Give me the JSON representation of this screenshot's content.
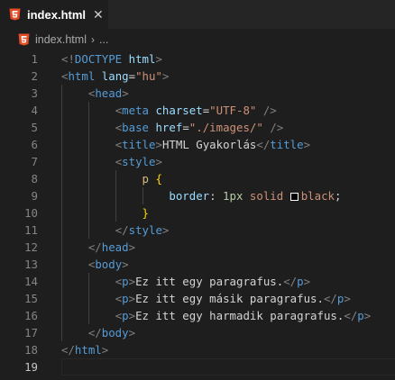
{
  "tab": {
    "filename": "index.html",
    "close_glyph": "✕",
    "icon": "html5-icon"
  },
  "breadcrumb": {
    "filename": "index.html",
    "separator": "›",
    "ellipsis": "..."
  },
  "colors": {
    "html_icon": "#e44d26",
    "tag": "#569cd6",
    "attr": "#9cdcfe",
    "string": "#ce9178",
    "bracket": "#808080"
  },
  "editor": {
    "active_line": 19,
    "lines": [
      {
        "n": "1",
        "tokens": [
          [
            "br",
            "<!"
          ],
          [
            "tag",
            "DOCTYPE"
          ],
          [
            "txt",
            " "
          ],
          [
            "attr",
            "html"
          ],
          [
            "br",
            ">"
          ]
        ]
      },
      {
        "n": "2",
        "tokens": [
          [
            "br",
            "<"
          ],
          [
            "tag",
            "html"
          ],
          [
            "txt",
            " "
          ],
          [
            "attr",
            "lang"
          ],
          [
            "txt",
            "="
          ],
          [
            "str",
            "\"hu\""
          ],
          [
            "br",
            ">"
          ]
        ]
      },
      {
        "n": "3",
        "indent": 1,
        "tokens": [
          [
            "br",
            "<"
          ],
          [
            "tag",
            "head"
          ],
          [
            "br",
            ">"
          ]
        ]
      },
      {
        "n": "4",
        "indent": 2,
        "tokens": [
          [
            "br",
            "<"
          ],
          [
            "tag",
            "meta"
          ],
          [
            "txt",
            " "
          ],
          [
            "attr",
            "charset"
          ],
          [
            "txt",
            "="
          ],
          [
            "str",
            "\"UTF-8\""
          ],
          [
            "txt",
            " "
          ],
          [
            "br",
            "/>"
          ]
        ]
      },
      {
        "n": "5",
        "indent": 2,
        "tokens": [
          [
            "br",
            "<"
          ],
          [
            "tag",
            "base"
          ],
          [
            "txt",
            " "
          ],
          [
            "attr",
            "href"
          ],
          [
            "txt",
            "="
          ],
          [
            "str",
            "\"./images/\""
          ],
          [
            "txt",
            " "
          ],
          [
            "br",
            "/>"
          ]
        ]
      },
      {
        "n": "6",
        "indent": 2,
        "tokens": [
          [
            "br",
            "<"
          ],
          [
            "tag",
            "title"
          ],
          [
            "br",
            ">"
          ],
          [
            "txt",
            "HTML Gyakorlás"
          ],
          [
            "br",
            "</"
          ],
          [
            "tag",
            "title"
          ],
          [
            "br",
            ">"
          ]
        ]
      },
      {
        "n": "7",
        "indent": 2,
        "tokens": [
          [
            "br",
            "<"
          ],
          [
            "tag",
            "style"
          ],
          [
            "br",
            ">"
          ]
        ]
      },
      {
        "n": "8",
        "indent": 3,
        "tokens": [
          [
            "sel",
            "p"
          ],
          [
            "txt",
            " "
          ],
          [
            "brace",
            "{"
          ]
        ]
      },
      {
        "n": "9",
        "indent": 4,
        "tokens": [
          [
            "prop",
            "border"
          ],
          [
            "txt",
            ": "
          ],
          [
            "num",
            "1px"
          ],
          [
            "txt",
            " "
          ],
          [
            "str",
            "solid"
          ],
          [
            "txt",
            " "
          ],
          [
            "swatch",
            ""
          ],
          [
            "str",
            "black"
          ],
          [
            "txt",
            ";"
          ]
        ]
      },
      {
        "n": "10",
        "indent": 3,
        "tokens": [
          [
            "brace",
            "}"
          ]
        ]
      },
      {
        "n": "11",
        "indent": 2,
        "tokens": [
          [
            "br",
            "</"
          ],
          [
            "tag",
            "style"
          ],
          [
            "br",
            ">"
          ]
        ]
      },
      {
        "n": "12",
        "indent": 1,
        "tokens": [
          [
            "br",
            "</"
          ],
          [
            "tag",
            "head"
          ],
          [
            "br",
            ">"
          ]
        ]
      },
      {
        "n": "13",
        "indent": 1,
        "tokens": [
          [
            "br",
            "<"
          ],
          [
            "tag",
            "body"
          ],
          [
            "br",
            ">"
          ]
        ]
      },
      {
        "n": "14",
        "indent": 2,
        "tokens": [
          [
            "br",
            "<"
          ],
          [
            "tag",
            "p"
          ],
          [
            "br",
            ">"
          ],
          [
            "txt",
            "Ez itt egy paragrafus."
          ],
          [
            "br",
            "</"
          ],
          [
            "tag",
            "p"
          ],
          [
            "br",
            ">"
          ]
        ]
      },
      {
        "n": "15",
        "indent": 2,
        "tokens": [
          [
            "br",
            "<"
          ],
          [
            "tag",
            "p"
          ],
          [
            "br",
            ">"
          ],
          [
            "txt",
            "Ez itt egy másik paragrafus."
          ],
          [
            "br",
            "</"
          ],
          [
            "tag",
            "p"
          ],
          [
            "br",
            ">"
          ]
        ]
      },
      {
        "n": "16",
        "indent": 2,
        "tokens": [
          [
            "br",
            "<"
          ],
          [
            "tag",
            "p"
          ],
          [
            "br",
            ">"
          ],
          [
            "txt",
            "Ez itt egy harmadik paragrafus."
          ],
          [
            "br",
            "</"
          ],
          [
            "tag",
            "p"
          ],
          [
            "br",
            ">"
          ]
        ]
      },
      {
        "n": "17",
        "indent": 1,
        "tokens": [
          [
            "br",
            "</"
          ],
          [
            "tag",
            "body"
          ],
          [
            "br",
            ">"
          ]
        ]
      },
      {
        "n": "18",
        "tokens": [
          [
            "br",
            "</"
          ],
          [
            "tag",
            "html"
          ],
          [
            "br",
            ">"
          ]
        ]
      },
      {
        "n": "19",
        "tokens": []
      }
    ]
  }
}
